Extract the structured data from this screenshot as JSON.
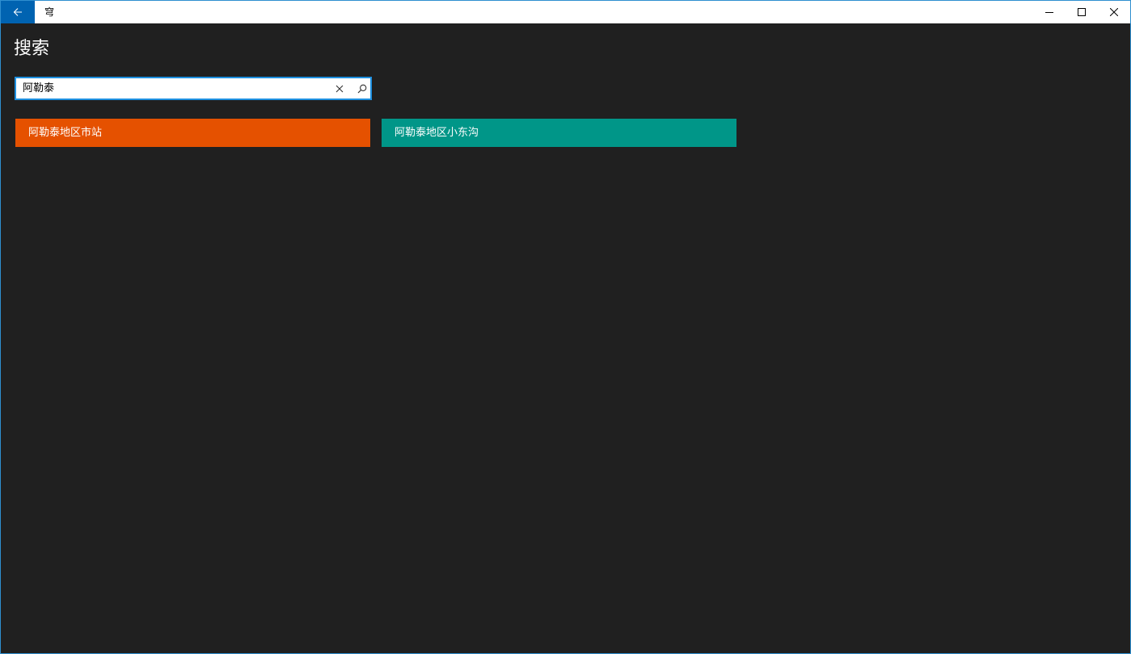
{
  "window": {
    "app_title": "穹",
    "accent_color": "#0063b1",
    "border_color": "#2f8fd0"
  },
  "titlebar": {
    "back_icon": "arrow-left-icon",
    "minimize_icon": "minimize-icon",
    "maximize_icon": "maximize-icon",
    "close_icon": "close-icon"
  },
  "page": {
    "title": "搜索"
  },
  "search": {
    "value": "阿勒泰",
    "clear_icon": "clear-icon",
    "search_icon": "search-icon"
  },
  "results": [
    {
      "label": "阿勒泰地区市站",
      "color": "#e55100"
    },
    {
      "label": "阿勒泰地区小东沟",
      "color": "#009688"
    }
  ]
}
